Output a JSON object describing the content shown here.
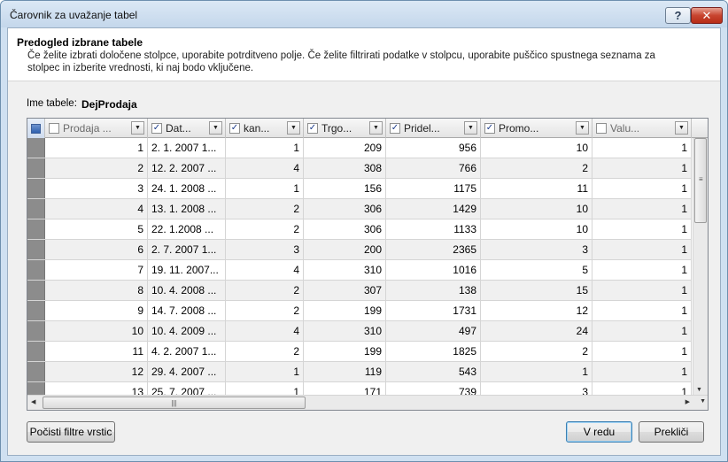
{
  "window": {
    "title": "Čarovnik za uvažanje tabel",
    "help_label": "?",
    "close_label": "✕"
  },
  "header": {
    "title": "Predogled izbrane tabele",
    "description": "Če želite izbrati določene stolpce, uporabite potrditveno polje. Če želite filtrirati podatke v stolpcu, uporabite puščico spustnega seznama za stolpec in izberite vrednosti, ki naj bodo vključene."
  },
  "table_name": {
    "label": "Ime tabele:",
    "value": "DejProdaja"
  },
  "grid": {
    "columns": [
      {
        "label": "Prodaja ...",
        "checked": false,
        "align": "num"
      },
      {
        "label": "Dat...",
        "checked": true,
        "align": "txt"
      },
      {
        "label": "kan...",
        "checked": true,
        "align": "num"
      },
      {
        "label": "Trgo...",
        "checked": true,
        "align": "num"
      },
      {
        "label": "Pridel...",
        "checked": true,
        "align": "num"
      },
      {
        "label": "Promo...",
        "checked": true,
        "align": "num"
      },
      {
        "label": "Valu...",
        "checked": false,
        "align": "num"
      }
    ],
    "rows": [
      [
        "1",
        "2. 1. 2007 1...",
        "1",
        "209",
        "956",
        "10",
        "1"
      ],
      [
        "2",
        "12. 2. 2007 ...",
        "4",
        "308",
        "766",
        "2",
        "1"
      ],
      [
        "3",
        "24. 1. 2008 ...",
        "1",
        "156",
        "1175",
        "11",
        "1"
      ],
      [
        "4",
        "13. 1. 2008 ...",
        "2",
        "306",
        "1429",
        "10",
        "1"
      ],
      [
        "5",
        "22. 1.2008 ...",
        "2",
        "306",
        "1133",
        "10",
        "1"
      ],
      [
        "6",
        "2. 7. 2007 1...",
        "3",
        "200",
        "2365",
        "3",
        "1"
      ],
      [
        "7",
        "19. 11. 2007...",
        "4",
        "310",
        "1016",
        "5",
        "1"
      ],
      [
        "8",
        "10. 4. 2008 ...",
        "2",
        "307",
        "138",
        "15",
        "1"
      ],
      [
        "9",
        "14. 7. 2008 ...",
        "2",
        "199",
        "1731",
        "12",
        "1"
      ],
      [
        "10",
        "10. 4. 2009 ...",
        "4",
        "310",
        "497",
        "24",
        "1"
      ],
      [
        "11",
        "4. 2. 2007 1...",
        "2",
        "199",
        "1825",
        "2",
        "1"
      ],
      [
        "12",
        "29. 4. 2007 ...",
        "1",
        "119",
        "543",
        "1",
        "1"
      ],
      [
        "13",
        "25. 7. 2007 ...",
        "1",
        "171",
        "739",
        "3",
        "1"
      ]
    ]
  },
  "buttons": {
    "clear_filters": "Počisti filtre vrstic",
    "ok": "V redu",
    "cancel": "Prekliči"
  },
  "icons": {
    "dropdown": "chevron-down-icon",
    "select_all": "select-all-icon"
  }
}
